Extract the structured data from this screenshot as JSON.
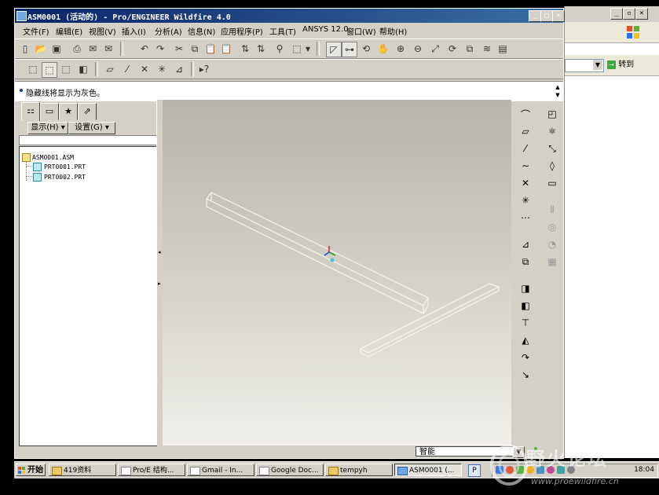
{
  "window": {
    "title": "ASM0001 (活动的) - Pro/ENGINEER Wildfire 4.0"
  },
  "menu": [
    "文件(F)",
    "编辑(E)",
    "视图(V)",
    "插入(I)",
    "分析(A)",
    "信息(N)",
    "应用程序(P)",
    "工具(T)",
    "ANSYS 12.0",
    "窗口(W)",
    "帮助(H)"
  ],
  "message": "隐藏线将显示为灰色。",
  "navigator": {
    "show_label": "显示(H)",
    "settings_label": "设置(G)",
    "tree": [
      {
        "label": "ASM0001.ASM",
        "level": 0
      },
      {
        "label": "PRT0001.PRT",
        "level": 1
      },
      {
        "label": "PRT0002.PRT",
        "level": 1
      }
    ]
  },
  "status": {
    "filter_value": "智能"
  },
  "bg_window": {
    "go_label": "转到"
  },
  "taskbar": {
    "start_label": "开始",
    "tasks": [
      {
        "label": "419资料",
        "active": false
      },
      {
        "label": "Pro/E 结构...",
        "active": false
      },
      {
        "label": "Gmail - In...",
        "active": false
      },
      {
        "label": "Google Doc...",
        "active": false
      },
      {
        "label": "tempyh",
        "active": false
      },
      {
        "label": "ASM0001 (...",
        "active": true
      }
    ],
    "clock": "18:04"
  },
  "watermark": {
    "title": "野火论坛",
    "url": "www.proewildfire.cn"
  },
  "colors": {
    "title_start": "#0a246a",
    "title_end": "#3a6ea5",
    "chrome": "#d4d0c8",
    "accent_icon": "#2a8fa8"
  }
}
